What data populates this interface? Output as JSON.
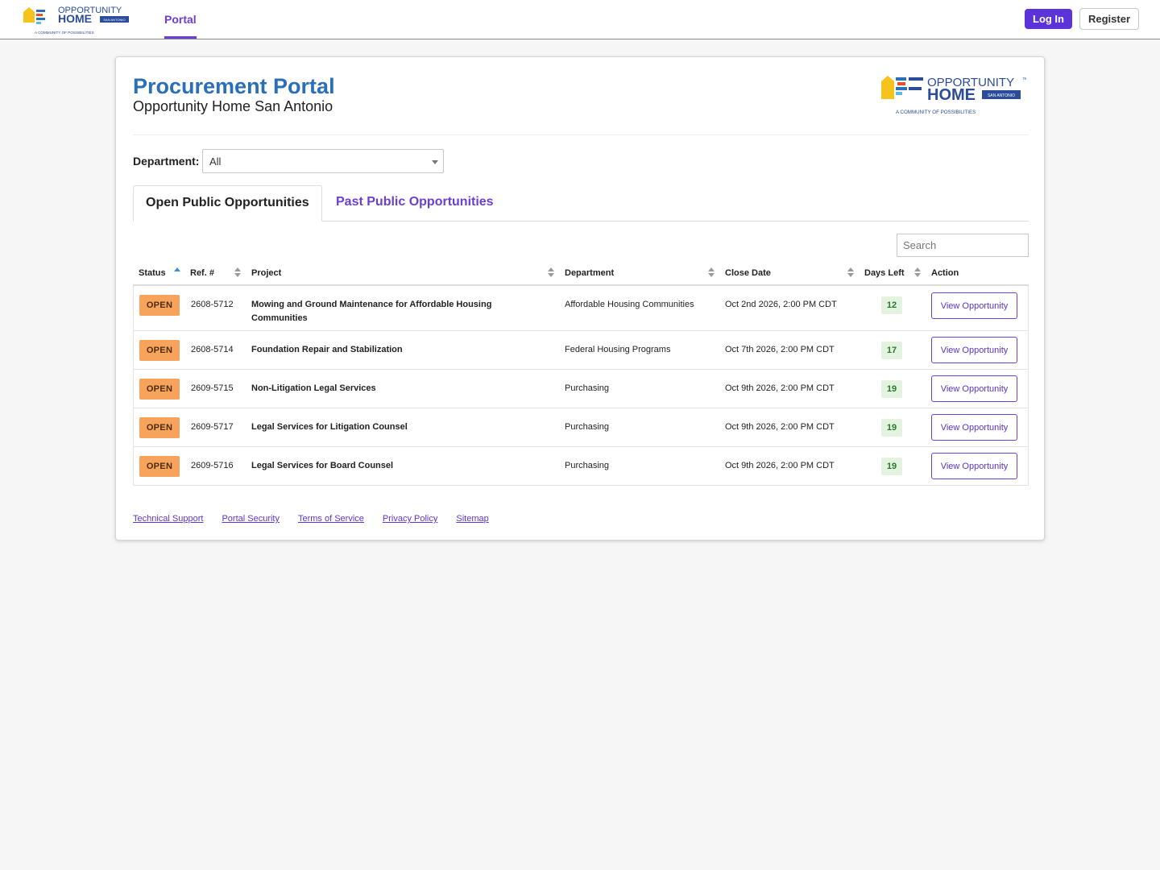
{
  "header": {
    "nav_portal": "Portal",
    "login_label": "Log In",
    "register_label": "Register"
  },
  "logo": {
    "line1": "OPPORTUNITY",
    "tm": "™",
    "line2": "HOME",
    "tag": "SAN ANTONIO",
    "slogan": "A COMMUNITY OF POSSIBILITIES"
  },
  "page": {
    "title": "Procurement Portal",
    "subtitle": "Opportunity Home San Antonio"
  },
  "filter": {
    "department_label": "Department:",
    "department_value": "All"
  },
  "tabs": {
    "open": "Open Public Opportunities",
    "past": "Past Public Opportunities"
  },
  "search": {
    "placeholder": "Search"
  },
  "table": {
    "headers": {
      "status": "Status",
      "ref": "Ref. #",
      "project": "Project",
      "department": "Department",
      "close_date": "Close Date",
      "days_left": "Days Left",
      "action": "Action"
    },
    "rows": [
      {
        "status": "OPEN",
        "ref": "2608-5712",
        "project": "Mowing and Ground Maintenance for Affordable Housing Communities",
        "department": "Affordable Housing Communities",
        "close_date": "Oct 2nd 2026, 2:00 PM CDT",
        "days_left": "12",
        "action": "View Opportunity"
      },
      {
        "status": "OPEN",
        "ref": "2608-5714",
        "project": "Foundation Repair and Stabilization",
        "department": "Federal Housing Programs",
        "close_date": "Oct 7th 2026, 2:00 PM CDT",
        "days_left": "17",
        "action": "View Opportunity"
      },
      {
        "status": "OPEN",
        "ref": "2609-5715",
        "project": "Non-Litigation Legal Services",
        "department": "Purchasing",
        "close_date": "Oct 9th 2026, 2:00 PM CDT",
        "days_left": "19",
        "action": "View Opportunity"
      },
      {
        "status": "OPEN",
        "ref": "2609-5717",
        "project": "Legal Services for Litigation Counsel",
        "department": "Purchasing",
        "close_date": "Oct 9th 2026, 2:00 PM CDT",
        "days_left": "19",
        "action": "View Opportunity"
      },
      {
        "status": "OPEN",
        "ref": "2609-5716",
        "project": "Legal Services for Board Counsel",
        "department": "Purchasing",
        "close_date": "Oct 9th 2026, 2:00 PM CDT",
        "days_left": "19",
        "action": "View Opportunity"
      }
    ]
  },
  "footer": {
    "links": [
      "Technical Support",
      "Portal Security",
      "Terms of Service",
      "Privacy Policy",
      "Sitemap"
    ]
  },
  "colors": {
    "accent": "#5b33d9",
    "title_blue": "#2a6fb8",
    "badge_open": "#f7a35c",
    "days_bg": "#e4f3e0"
  }
}
